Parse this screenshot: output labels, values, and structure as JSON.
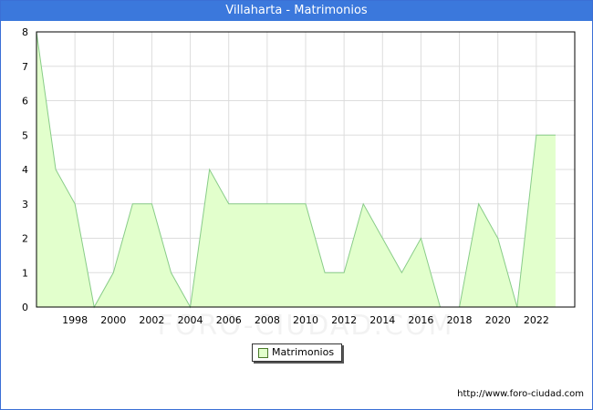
{
  "title": "Villaharta - Matrimonios",
  "watermark": "FORO-CIUDAD.COM",
  "footer_url": "http://www.foro-ciudad.com",
  "colors": {
    "header": "#3b78dc",
    "fill": "#e2ffcc",
    "line": "#88cc88",
    "grid": "#dddddd"
  },
  "chart_data": {
    "type": "area",
    "title": "Villaharta - Matrimonios",
    "xlabel": "",
    "ylabel": "",
    "x": [
      1996,
      1997,
      1998,
      1999,
      2000,
      2001,
      2002,
      2003,
      2004,
      2005,
      2006,
      2007,
      2008,
      2009,
      2010,
      2011,
      2012,
      2013,
      2014,
      2015,
      2016,
      2017,
      2018,
      2019,
      2020,
      2021,
      2022,
      2023
    ],
    "series": [
      {
        "name": "Matrimonios",
        "values": [
          8,
          4,
          3,
          0,
          1,
          3,
          3,
          1,
          0,
          4,
          3,
          3,
          3,
          3,
          3,
          1,
          1,
          3,
          2,
          1,
          2,
          0,
          0,
          3,
          2,
          0,
          5,
          5
        ]
      }
    ],
    "xlim": [
      1996,
      2024
    ],
    "ylim": [
      0,
      8
    ],
    "x_ticks": [
      "1998",
      "2000",
      "2002",
      "2004",
      "2006",
      "2008",
      "2010",
      "2012",
      "2014",
      "2016",
      "2018",
      "2020",
      "2022"
    ],
    "y_ticks": [
      "0",
      "1",
      "2",
      "3",
      "4",
      "5",
      "6",
      "7",
      "8"
    ],
    "grid": true,
    "legend": "bottom-center"
  }
}
